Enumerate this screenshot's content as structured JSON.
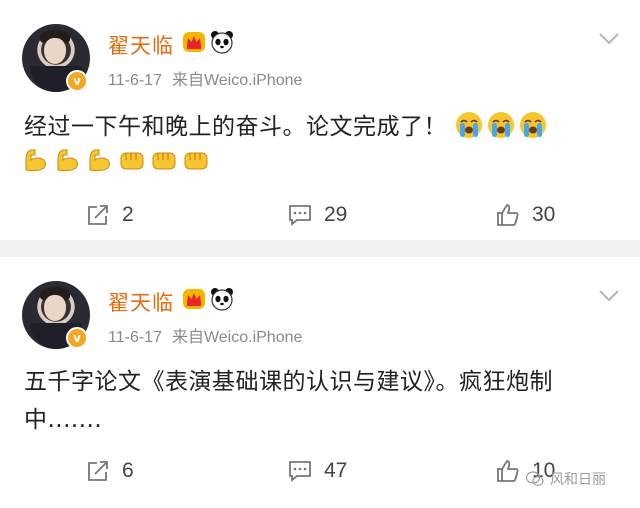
{
  "posts": [
    {
      "username": "翟天临",
      "date": "11-6-17",
      "source": "来自Weico.iPhone",
      "text": "经过一下午和晚上的奋斗。论文完成了！",
      "reposts": "2",
      "comments": "29",
      "likes": "30"
    },
    {
      "username": "翟天临",
      "date": "11-6-17",
      "source": "来自Weico.iPhone",
      "text": "五千字论文《表演基础课的认识与建议》。疯狂炮制中.......",
      "reposts": "6",
      "comments": "47",
      "likes": "10"
    }
  ],
  "watermark": "风和日丽",
  "icons": {
    "verified_badge": "v-badge-icon",
    "crown": "crown-icon",
    "panda": "panda-icon",
    "more": "chevron-down-icon",
    "repost": "share-icon",
    "comment": "comment-icon",
    "like": "thumbs-up-icon",
    "crying": "crying-face-emoji",
    "muscle": "flexed-biceps-emoji",
    "fist": "fist-emoji"
  },
  "colors": {
    "username": "#e86b0f",
    "meta": "#8a8a8a",
    "badge": "#f5a623",
    "background": "#f2f2f2"
  }
}
